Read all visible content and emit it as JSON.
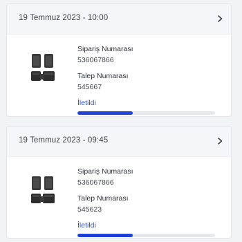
{
  "orders": [
    {
      "date": "19 Temmuz 2023 - 10:00",
      "order_number_label": "Sipariş Numarası",
      "order_number": "536067866",
      "request_number_label": "Talep Numarası",
      "request_number": "545667",
      "status": "İletildi",
      "progress": 0.4,
      "product_icon": "car-floor-mats-image",
      "chevron_icon": "chevron-right-icon"
    },
    {
      "date": "19 Temmuz 2023 - 09:45",
      "order_number_label": "Sipariş Numarası",
      "order_number": "536067866",
      "request_number_label": "Talep Numarası",
      "request_number": "545623",
      "status": "İletildi",
      "progress": 0.4,
      "product_icon": "car-floor-mats-image",
      "chevron_icon": "chevron-right-icon"
    }
  ],
  "colors": {
    "status_text": "#2a4fc7",
    "progress_fill": "#1f3fd6",
    "progress_track": "#e6e8eb",
    "header_bg": "#f5f6f8"
  }
}
